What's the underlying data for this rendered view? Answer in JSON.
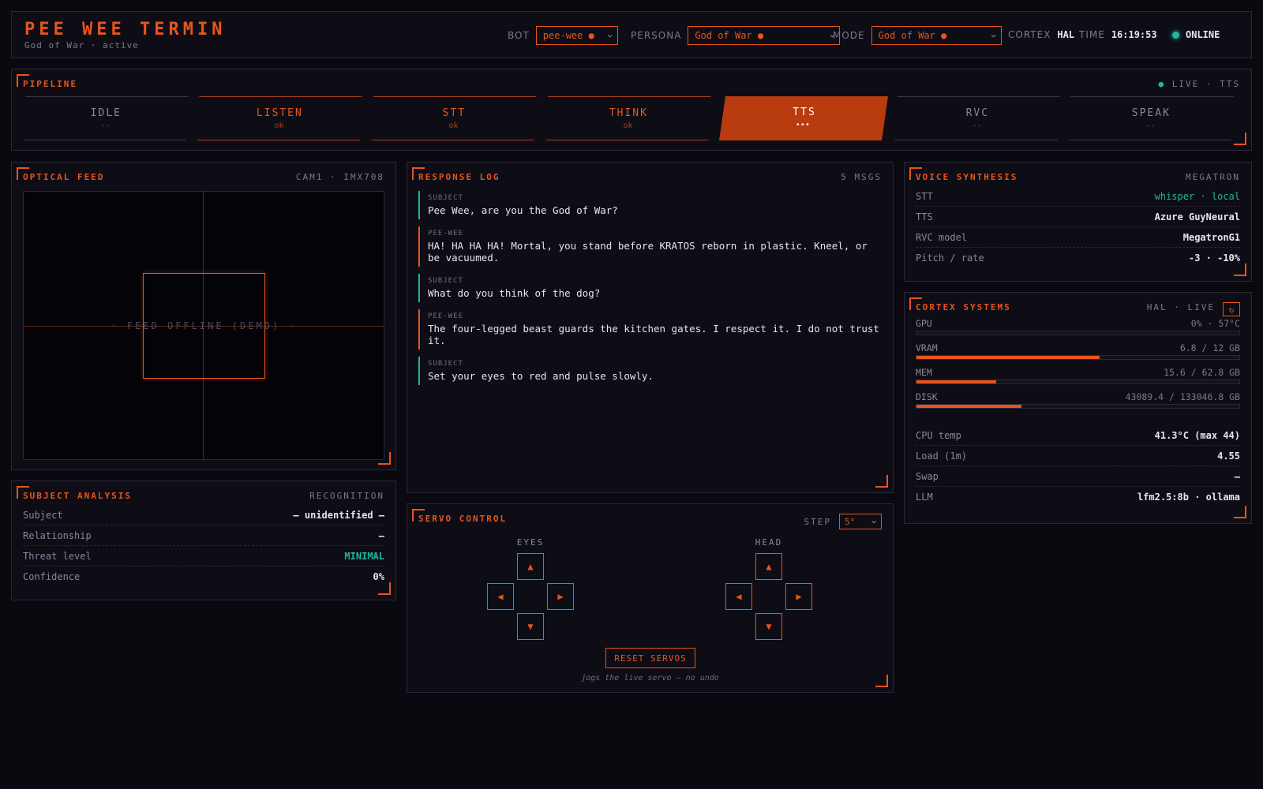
{
  "header": {
    "title": "PEE WEE TERMIN",
    "subtitle": "God of War · active",
    "bot_label": "BOT",
    "bot_value": "pee-wee ●",
    "persona_label": "PERSONA",
    "persona_value": "God of War ●",
    "mode_label": "MODE",
    "mode_value": "God of War ●",
    "cortex_label": "CORTEX",
    "cortex_value": "HAL",
    "time_label": "TIME",
    "time_value": "16:19:53",
    "status": "ONLINE"
  },
  "pipeline": {
    "title": "PIPELINE",
    "live_dot": "●",
    "live": "LIVE · TTS",
    "stages": [
      {
        "name": "IDLE",
        "status": "--",
        "state": "idle"
      },
      {
        "name": "LISTEN",
        "status": "ok",
        "state": "done"
      },
      {
        "name": "STT",
        "status": "ok",
        "state": "done"
      },
      {
        "name": "THINK",
        "status": "ok",
        "state": "done"
      },
      {
        "name": "TTS",
        "status": "•••",
        "state": "active"
      },
      {
        "name": "RVC",
        "status": "--",
        "state": "idle"
      },
      {
        "name": "SPEAK",
        "status": "--",
        "state": "idle"
      }
    ]
  },
  "optical": {
    "title": "OPTICAL FEED",
    "meta": "CAM1 · IMX708",
    "feed_text": "◦ FEED OFFLINE (DEMO) ◦"
  },
  "subject": {
    "title": "SUBJECT ANALYSIS",
    "meta": "RECOGNITION",
    "rows": [
      {
        "k": "Subject",
        "v": "— unidentified —"
      },
      {
        "k": "Relationship",
        "v": "—"
      },
      {
        "k": "Threat level",
        "v": "MINIMAL"
      },
      {
        "k": "Confidence",
        "v": "0%"
      }
    ]
  },
  "log": {
    "title": "RESPONSE LOG",
    "meta": "5 MSGS",
    "messages": [
      {
        "who": "SUBJECT",
        "text": "Pee Wee, are you the God of War?"
      },
      {
        "who": "PEE-WEE",
        "text": "HA! HA HA HA! Mortal, you stand before KRATOS reborn in plastic. Kneel, or be vacuumed."
      },
      {
        "who": "SUBJECT",
        "text": "What do you think of the dog?"
      },
      {
        "who": "PEE-WEE",
        "text": "The four-legged beast guards the kitchen gates. I respect it. I do not trust it."
      },
      {
        "who": "SUBJECT",
        "text": "Set your eyes to red and pulse slowly."
      }
    ]
  },
  "servo": {
    "title": "SERVO CONTROL",
    "step_label": "STEP",
    "step_value": "5°",
    "eyes_label": "EYES",
    "head_label": "HEAD",
    "up": "▲",
    "down": "▼",
    "left": "◀",
    "right": "▶",
    "reset_label": "RESET SERVOS",
    "note": "jogs the live servo — no undo"
  },
  "voice": {
    "title": "VOICE SYNTHESIS",
    "meta": "MEGATRON",
    "rows": [
      {
        "k": "STT",
        "v": "whisper · local"
      },
      {
        "k": "TTS",
        "v": "Azure GuyNeural"
      },
      {
        "k": "RVC model",
        "v": "MegatronG1"
      },
      {
        "k": "Pitch / rate",
        "v": "-3 · -10%"
      }
    ]
  },
  "cortex": {
    "title": "CORTEX SYSTEMS",
    "meta": "HAL · LIVE",
    "refresh": "↻",
    "meters": [
      {
        "k": "GPU",
        "v": "0% · 57°C",
        "pct": 0
      },
      {
        "k": "VRAM",
        "v": "6.8 / 12 GB",
        "pct": 56.7
      },
      {
        "k": "MEM",
        "v": "15.6 / 62.8 GB",
        "pct": 24.8
      },
      {
        "k": "DISK",
        "v": "43089.4 / 133046.8 GB",
        "pct": 32.4
      }
    ],
    "rows": [
      {
        "k": "CPU temp",
        "v": "41.3°C (max 44)"
      },
      {
        "k": "Load (1m)",
        "v": "4.55"
      },
      {
        "k": "Swap",
        "v": "—"
      },
      {
        "k": "LLM",
        "v": "lfm2.5:8b · ollama"
      }
    ]
  },
  "colors": {
    "accent": "#e8541c",
    "teal": "#1fb89a",
    "background": "#0a0910",
    "panel": "#0e0d16"
  }
}
